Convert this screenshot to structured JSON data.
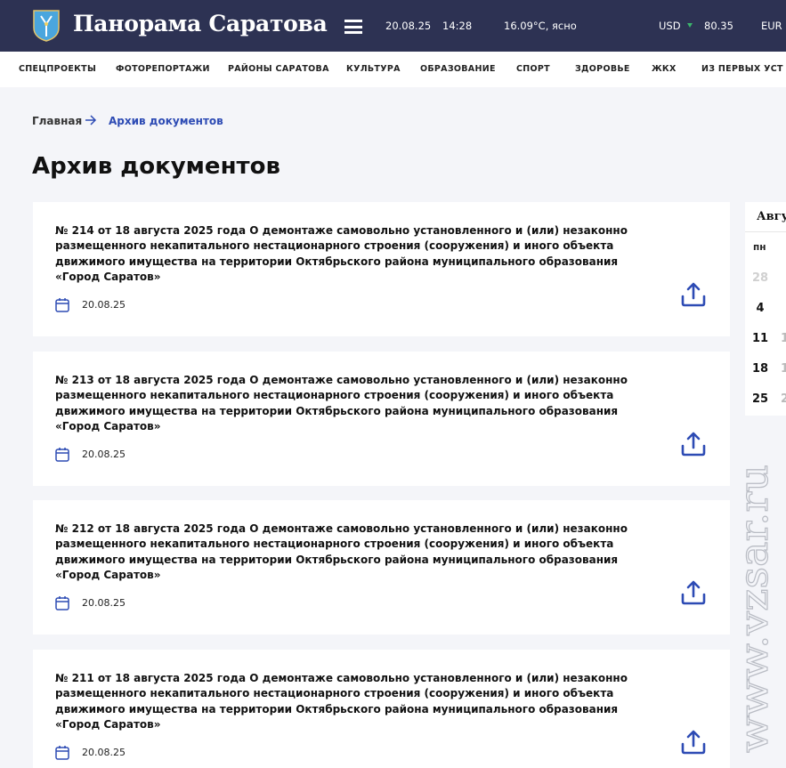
{
  "header": {
    "site_title": "Панорама Саратова",
    "date": "20.08.25",
    "time": "14:28",
    "weather": "16.09°С, ясно",
    "currency_usd_label": "USD",
    "currency_usd_value": "80.35",
    "currency_eur_label": "EUR",
    "icons": {
      "logo": "saratov-coat-of-arms-icon",
      "menu": "hamburger-menu-icon",
      "trend": "down-triangle-icon"
    },
    "colors": {
      "bar": "#2d3253",
      "trend_down": "#3bb56c"
    }
  },
  "nav": {
    "items": [
      "СПЕЦПРОЕКТЫ",
      "ФОТОРЕПОРТАЖИ",
      "РАЙОНЫ САРАТОВА",
      "КУЛЬТУРА",
      "ОБРАЗОВАНИЕ",
      "СПОРТ",
      "ЗДОРОВЬЕ",
      "ЖКХ",
      "ИЗ ПЕРВЫХ УСТ"
    ]
  },
  "breadcrumb": {
    "home": "Главная",
    "current": "Архив документов"
  },
  "page": {
    "title": "Архив документов"
  },
  "documents": [
    {
      "title": "№ 214 от 18 августа 2025 года О демонтаже самовольно установленного и (или) незаконно размещенного некапитального нестационарного строения (сооружения) и иного объекта движимого имущества на территории Октябрьского района муниципального образования «Город Саратов»",
      "date": "20.08.25"
    },
    {
      "title": "№ 213 от 18 августа 2025 года О демонтаже самовольно установленного и (или) незаконно размещенного некапитального нестационарного строения (сооружения) и иного объекта движимого имущества на территории Октябрьского района муниципального образования «Город Саратов»",
      "date": "20.08.25"
    },
    {
      "title": "№ 212 от 18 августа 2025 года О демонтаже самовольно установленного и (или) незаконно размещенного некапитального нестационарного строения (сооружения) и иного объекта движимого имущества на территории Октябрьского района муниципального образования «Город Саратов»",
      "date": "20.08.25"
    },
    {
      "title": "№ 211 от 18 августа 2025 года О демонтаже самовольно установленного и (или) незаконно размещенного некапитального нестационарного строения (сооружения) и иного объекта движимого имущества на территории Октябрьского района муниципального образования «Город Саратов»",
      "date": "20.08.25"
    }
  ],
  "calendar": {
    "month": "Авгу",
    "dow": "пн",
    "days": [
      "28",
      "4",
      "11",
      "18",
      "25"
    ],
    "next_col": [
      "2",
      "1",
      "1",
      "2"
    ]
  },
  "watermark": "www.vzsar.ru",
  "colors": {
    "accent": "#2d4bb4",
    "page_bg": "#f4f5f9"
  }
}
